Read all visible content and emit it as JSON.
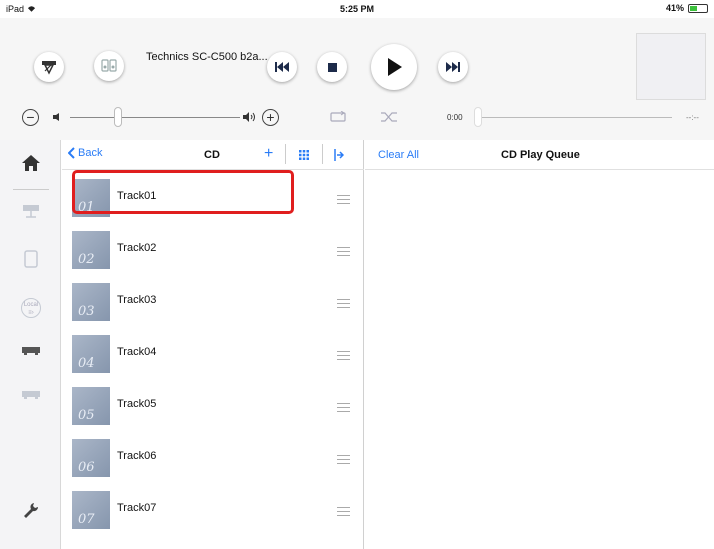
{
  "status_bar": {
    "device": "iPad",
    "time": "5:25 PM",
    "battery": "41%"
  },
  "player": {
    "device_name": "Technics SC-C500 b2a...",
    "current_time": "0:00",
    "total_time": "--:--"
  },
  "list_panel": {
    "back_label": "Back",
    "title": "CD",
    "tracks": [
      {
        "number": "01",
        "name": "Track01"
      },
      {
        "number": "02",
        "name": "Track02"
      },
      {
        "number": "03",
        "name": "Track03"
      },
      {
        "number": "04",
        "name": "Track04"
      },
      {
        "number": "05",
        "name": "Track05"
      },
      {
        "number": "06",
        "name": "Track06"
      },
      {
        "number": "07",
        "name": "Track07"
      }
    ]
  },
  "rail": {
    "local_label": "Local"
  },
  "queue_panel": {
    "clear_label": "Clear All",
    "title": "CD Play Queue"
  },
  "colors": {
    "accent": "#2a7cf6",
    "highlight": "#e01e1e",
    "background": "#ffffff",
    "rail_background": "#f4f4f6"
  }
}
